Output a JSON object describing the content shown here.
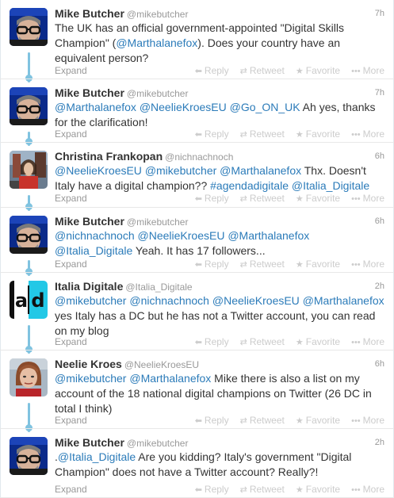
{
  "actions": {
    "expand": "Expand",
    "reply": "Reply",
    "retweet": "Retweet",
    "favorite": "Favorite",
    "more": "More"
  },
  "colors": {
    "link": "#2b7bb9",
    "thread_line": "#80c3e0",
    "muted": "#999999"
  },
  "tweets": [
    {
      "name": "Mike Butcher",
      "handle": "@mikebutcher",
      "time": "7h",
      "avatar": "mike-butcher",
      "text": [
        {
          "t": "The UK has an official government-appointed \"Digital Skills Champion\" ("
        },
        {
          "t": "@Marthalanefox",
          "link": true
        },
        {
          "t": "). Does your country have an equivalent person?"
        }
      ]
    },
    {
      "name": "Mike Butcher",
      "handle": "@mikebutcher",
      "time": "7h",
      "avatar": "mike-butcher",
      "text": [
        {
          "t": "@Marthalanefox",
          "link": true
        },
        {
          "t": " "
        },
        {
          "t": "@NeelieKroesEU",
          "link": true
        },
        {
          "t": " "
        },
        {
          "t": "@Go_ON_UK",
          "link": true
        },
        {
          "t": " Ah yes, thanks for the clarification!"
        }
      ]
    },
    {
      "name": "Christina Frankopan",
      "handle": "@nichnachnoch",
      "time": "6h",
      "avatar": "christina-frankopan",
      "text": [
        {
          "t": "@NeelieKroesEU",
          "link": true
        },
        {
          "t": " "
        },
        {
          "t": "@mikebutcher",
          "link": true
        },
        {
          "t": " "
        },
        {
          "t": "@Marthalanefox",
          "link": true
        },
        {
          "t": " Thx. Doesn't Italy have a digital champion?? "
        },
        {
          "t": "#agendadigitale",
          "link": true
        },
        {
          "t": " "
        },
        {
          "t": "@Italia_Digitale",
          "link": true
        }
      ]
    },
    {
      "name": "Mike Butcher",
      "handle": "@mikebutcher",
      "time": "6h",
      "avatar": "mike-butcher",
      "text": [
        {
          "t": "@nichnachnoch",
          "link": true
        },
        {
          "t": " "
        },
        {
          "t": "@NeelieKroesEU",
          "link": true
        },
        {
          "t": " "
        },
        {
          "t": "@Marthalanefox",
          "link": true
        },
        {
          "t": " "
        },
        {
          "t": "@Italia_Digitale",
          "link": true
        },
        {
          "t": " Yeah. It has 17 followers..."
        }
      ]
    },
    {
      "name": "Italia Digitale",
      "handle": "@Italia_Digitale",
      "time": "2h",
      "avatar": "italia-digitale",
      "text": [
        {
          "t": "@mikebutcher",
          "link": true
        },
        {
          "t": " "
        },
        {
          "t": "@nichnachnoch",
          "link": true
        },
        {
          "t": " "
        },
        {
          "t": "@NeelieKroesEU",
          "link": true
        },
        {
          "t": " "
        },
        {
          "t": "@Marthalanefox",
          "link": true
        },
        {
          "t": " yes Italy has a DC but he has not a Twitter account, you can read on my blog"
        }
      ]
    },
    {
      "name": "Neelie Kroes",
      "handle": "@NeelieKroesEU",
      "time": "6h",
      "avatar": "neelie-kroes",
      "text": [
        {
          "t": "@mikebutcher",
          "link": true
        },
        {
          "t": " "
        },
        {
          "t": "@Marthalanefox",
          "link": true
        },
        {
          "t": " Mike there is also a list on my account of the 18 national digital champions on Twitter (26 DC in total I think)"
        }
      ]
    },
    {
      "name": "Mike Butcher",
      "handle": "@mikebutcher",
      "time": "2h",
      "avatar": "mike-butcher",
      "text": [
        {
          "t": "."
        },
        {
          "t": "@Italia_Digitale",
          "link": true
        },
        {
          "t": " Are you kidding? Italy's government \"Digital Champion\" does not have a Twitter account? Really?!"
        }
      ]
    }
  ]
}
